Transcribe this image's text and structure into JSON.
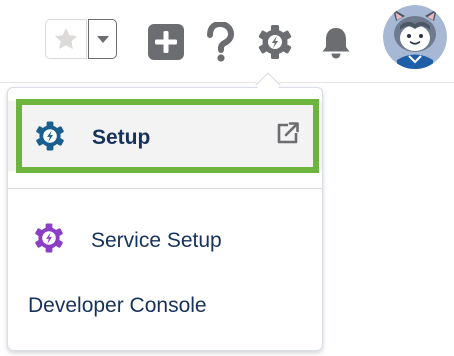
{
  "header": {
    "favorites_star_icon": "star-icon",
    "favorites_list_icon": "chevron-down-icon",
    "add_icon": "plus-icon",
    "help_icon": "question-icon",
    "setup_gear_icon": "gear-icon",
    "notifications_icon": "bell-icon",
    "avatar": "user-avatar"
  },
  "setup_menu": {
    "items": [
      {
        "label": "Setup",
        "icon": "setup-gear-icon",
        "trailing_icon": "external-link-icon",
        "highlighted": true
      },
      {
        "label": "Service Setup",
        "icon": "service-setup-gear-icon"
      },
      {
        "label": "Developer Console"
      }
    ]
  },
  "colors": {
    "highlight_border": "#6db33f",
    "setup_icon": "#1b5f8f",
    "service_setup_icon": "#8b3fc5",
    "header_icon": "#6b6d70",
    "star_disabled": "#dddbda",
    "avatar_bg": "#a6b8d3",
    "text": "#16325c"
  }
}
